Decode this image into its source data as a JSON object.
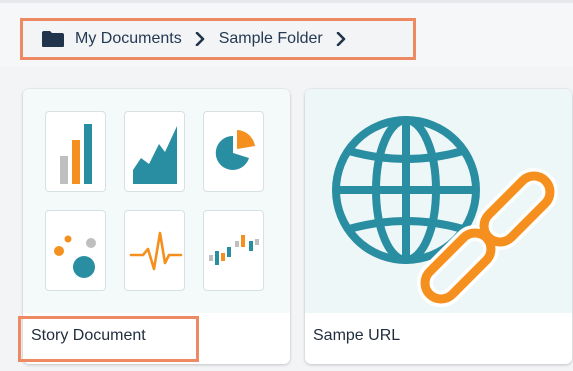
{
  "breadcrumb": {
    "items": [
      "My Documents",
      "Sample Folder"
    ]
  },
  "cards": [
    {
      "label": "Story Document",
      "icons": [
        "bar-chart-icon",
        "area-chart-icon",
        "pie-chart-icon",
        "scatter-chart-icon",
        "pulse-line-icon",
        "waterfall-chart-icon"
      ]
    },
    {
      "label": "Sampe URL",
      "icon": "globe-link-icon"
    }
  ],
  "colors": {
    "accent": "#ee8a63",
    "teal": "#2a8ea3",
    "orange": "#f5901e",
    "gray": "#bfbfbf",
    "text": "#243a52"
  }
}
